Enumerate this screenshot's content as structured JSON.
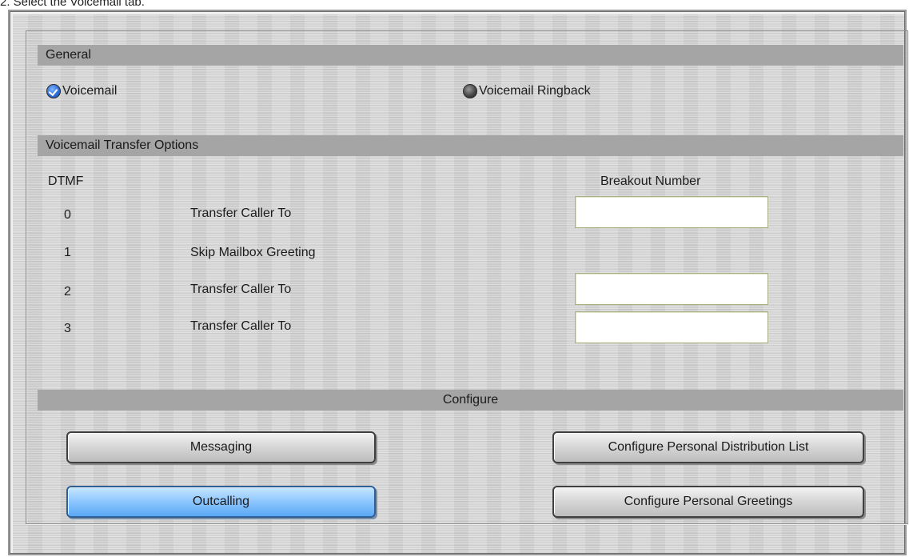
{
  "caption": "2. Select the Voicemail tab.",
  "general": {
    "header": "General",
    "voicemail": {
      "label": "Voicemail",
      "checked": true
    },
    "ringback": {
      "label": "Voicemail Ringback",
      "checked": false
    }
  },
  "transfer": {
    "header": "Voicemail Transfer Options",
    "dtmf_label": "DTMF",
    "breakout_label": "Breakout Number",
    "rows": [
      {
        "digit": "0",
        "action": "Transfer Caller To",
        "value": ""
      },
      {
        "digit": "1",
        "action": "Skip Mailbox Greeting"
      },
      {
        "digit": "2",
        "action": "Transfer Caller To",
        "value": ""
      },
      {
        "digit": "3",
        "action": "Transfer Caller To",
        "value": ""
      }
    ]
  },
  "configure": {
    "header": "Configure",
    "messaging": "Messaging",
    "outcalling": "Outcalling",
    "distribution_list": "Configure Personal Distribution List",
    "greetings": "Configure Personal Greetings"
  },
  "colors": {
    "header_bar": "#a5a5a5",
    "active_button": "#8cc6ff",
    "radio_checked": "#2f6fd6"
  }
}
